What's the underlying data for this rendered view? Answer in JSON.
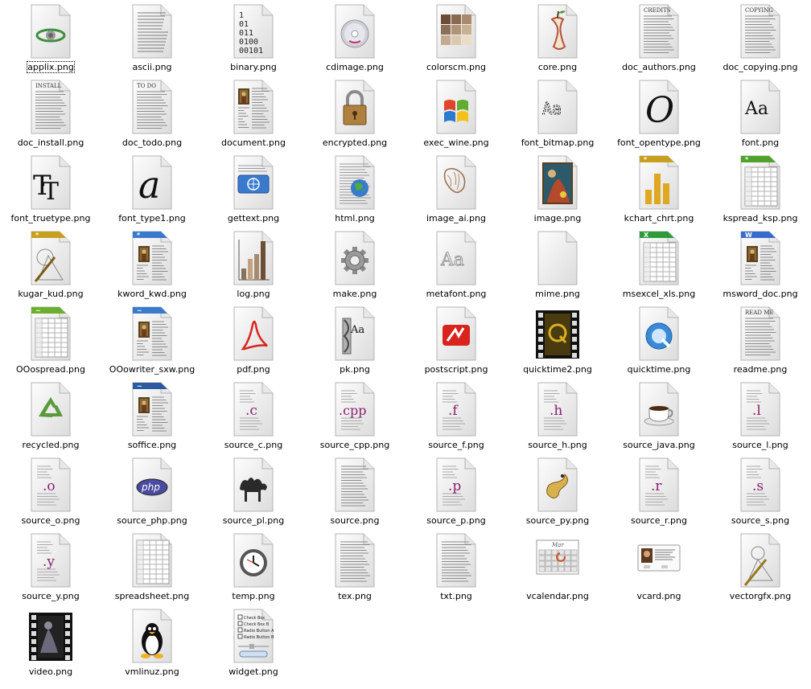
{
  "icons": [
    {
      "label": "applix.png",
      "icon": "applix-icon",
      "selected": true
    },
    {
      "label": "ascii.png",
      "icon": "ascii-icon"
    },
    {
      "label": "binary.png",
      "icon": "binary-icon",
      "lines": [
        "1",
        "01",
        "011",
        "0100",
        "00101"
      ]
    },
    {
      "label": "cdimage.png",
      "icon": "cd-image-icon"
    },
    {
      "label": "colorscm.png",
      "icon": "color-scheme-icon"
    },
    {
      "label": "core.png",
      "icon": "apple-core-icon"
    },
    {
      "label": "doc_authors.png",
      "icon": "document-authors-icon",
      "header": "CREDITS"
    },
    {
      "label": "doc_copying.png",
      "icon": "document-copying-icon",
      "header": "COPYING"
    },
    {
      "label": "doc_install.png",
      "icon": "document-install-icon",
      "header": "INSTALL"
    },
    {
      "label": "doc_todo.png",
      "icon": "document-todo-icon",
      "header": "TO DO"
    },
    {
      "label": "document.png",
      "icon": "document-icon"
    },
    {
      "label": "encrypted.png",
      "icon": "padlock-icon"
    },
    {
      "label": "exec_wine.png",
      "icon": "wine-executable-icon"
    },
    {
      "label": "font_bitmap.png",
      "icon": "bitmap-font-icon",
      "glyph": "Aa"
    },
    {
      "label": "font_opentype.png",
      "icon": "opentype-font-icon",
      "glyph": "O"
    },
    {
      "label": "font.png",
      "icon": "font-icon",
      "glyph": "Aa"
    },
    {
      "label": "font_truetype.png",
      "icon": "truetype-font-icon",
      "glyph": "TT"
    },
    {
      "label": "font_type1.png",
      "icon": "type1-font-icon",
      "glyph": "a"
    },
    {
      "label": "gettext.png",
      "icon": "gettext-icon"
    },
    {
      "label": "html.png",
      "icon": "html-globe-icon"
    },
    {
      "label": "image_ai.png",
      "icon": "vector-image-icon"
    },
    {
      "label": "image.png",
      "icon": "image-icon"
    },
    {
      "label": "kchart_chrt.png",
      "icon": "kchart-icon"
    },
    {
      "label": "kspread_ksp.png",
      "icon": "kspread-icon"
    },
    {
      "label": "kugar_kud.png",
      "icon": "kugar-icon"
    },
    {
      "label": "kword_kwd.png",
      "icon": "kword-icon"
    },
    {
      "label": "log.png",
      "icon": "log-chart-icon"
    },
    {
      "label": "make.png",
      "icon": "gear-icon"
    },
    {
      "label": "metafont.png",
      "icon": "metafont-icon",
      "glyph": "Aa"
    },
    {
      "label": "mime.png",
      "icon": "blank-document-icon"
    },
    {
      "label": "msexcel_xls.png",
      "icon": "msexcel-icon"
    },
    {
      "label": "msword_doc.png",
      "icon": "msword-icon"
    },
    {
      "label": "OOospread.png",
      "icon": "oo-spreadsheet-icon"
    },
    {
      "label": "OOowriter_sxw.png",
      "icon": "oo-writer-icon"
    },
    {
      "label": "pdf.png",
      "icon": "pdf-acrobat-icon"
    },
    {
      "label": "pk.png",
      "icon": "pk-font-icon",
      "glyph": "Aa"
    },
    {
      "label": "postscript.png",
      "icon": "postscript-icon"
    },
    {
      "label": "quicktime2.png",
      "icon": "quicktime-film-icon"
    },
    {
      "label": "quicktime.png",
      "icon": "quicktime-icon"
    },
    {
      "label": "readme.png",
      "icon": "readme-icon",
      "header": "READ ME"
    },
    {
      "label": "recycled.png",
      "icon": "recycle-icon"
    },
    {
      "label": "soffice.png",
      "icon": "staroffice-icon"
    },
    {
      "label": "source_c.png",
      "icon": "source-c-icon",
      "glyph": ".c"
    },
    {
      "label": "source_cpp.png",
      "icon": "source-cpp-icon",
      "glyph": ".cpp"
    },
    {
      "label": "source_f.png",
      "icon": "source-f-icon",
      "glyph": ".f"
    },
    {
      "label": "source_h.png",
      "icon": "source-h-icon",
      "glyph": ".h"
    },
    {
      "label": "source_java.png",
      "icon": "java-coffee-icon"
    },
    {
      "label": "source_l.png",
      "icon": "source-l-icon",
      "glyph": ".l"
    },
    {
      "label": "source_o.png",
      "icon": "source-o-icon",
      "glyph": ".o"
    },
    {
      "label": "source_php.png",
      "icon": "php-icon",
      "glyph": "php"
    },
    {
      "label": "source_pl.png",
      "icon": "perl-camel-icon"
    },
    {
      "label": "source.png",
      "icon": "source-icon"
    },
    {
      "label": "source_p.png",
      "icon": "source-p-icon",
      "glyph": ".p"
    },
    {
      "label": "source_py.png",
      "icon": "python-icon"
    },
    {
      "label": "source_r.png",
      "icon": "source-r-icon",
      "glyph": ".r"
    },
    {
      "label": "source_s.png",
      "icon": "source-s-icon",
      "glyph": ".s"
    },
    {
      "label": "source_y.png",
      "icon": "source-y-icon",
      "glyph": ".y"
    },
    {
      "label": "spreadsheet.png",
      "icon": "spreadsheet-icon"
    },
    {
      "label": "temp.png",
      "icon": "clock-icon"
    },
    {
      "label": "tex.png",
      "icon": "tex-icon"
    },
    {
      "label": "txt.png",
      "icon": "text-icon"
    },
    {
      "label": "vcalendar.png",
      "icon": "calendar-icon",
      "header": "Mar"
    },
    {
      "label": "vcard.png",
      "icon": "vcard-icon"
    },
    {
      "label": "vectorgfx.png",
      "icon": "vector-graphics-icon"
    },
    {
      "label": "video.png",
      "icon": "video-film-icon"
    },
    {
      "label": "vmlinuz.png",
      "icon": "tux-penguin-icon"
    },
    {
      "label": "widget.png",
      "icon": "widget-icon",
      "lines": [
        "Check Box",
        "Check Box B",
        "Radio Button A",
        "Radio Button B"
      ]
    }
  ]
}
